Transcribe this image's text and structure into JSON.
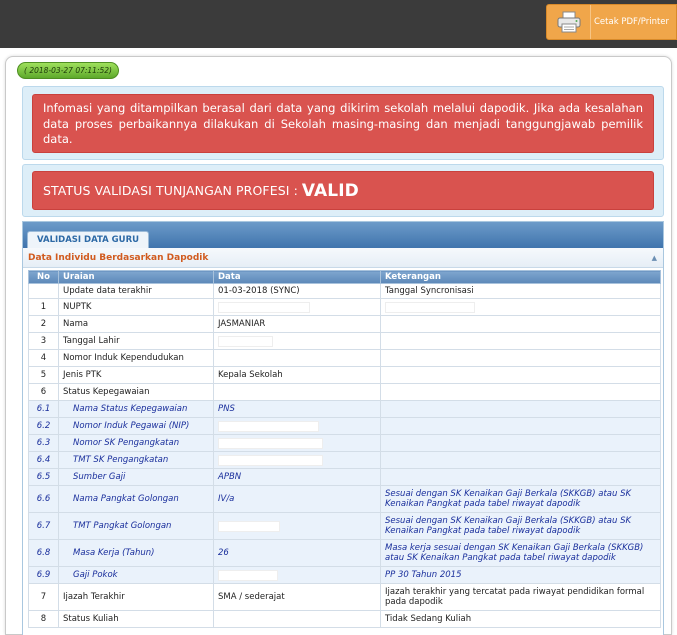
{
  "toolbar": {
    "print_label": "Cetak PDF/Printer"
  },
  "timestamp": "( 2018-03-27 07:11:52)",
  "info_message": "Infomasi yang ditampilkan berasal dari data yang dikirim sekolah melalui dapodik. Jika ada kesalahan data proses perbaikannya dilakukan di Sekolah masing-masing dan menjadi tanggungjawab pemilik data.",
  "status": {
    "label": "STATUS VALIDASI TUNJANGAN PROFESI :",
    "value": "VALID"
  },
  "tab": {
    "label": "VALIDASI DATA GURU"
  },
  "section": {
    "title": "Data Individu Berdasarkan Dapodik"
  },
  "table": {
    "headers": [
      "No",
      "Uraian",
      "Data",
      "Keterangan"
    ],
    "rows": [
      {
        "no": "",
        "uraian": "Update data terakhir",
        "data": "01-03-2018 (SYNC)",
        "keterangan": "Tanggal Syncronisasi"
      },
      {
        "no": "1",
        "uraian": "NUPTK",
        "data": "",
        "keterangan": ""
      },
      {
        "no": "2",
        "uraian": "Nama",
        "data": "JASMANIAR",
        "keterangan": ""
      },
      {
        "no": "3",
        "uraian": "Tanggal Lahir",
        "data": "",
        "keterangan": ""
      },
      {
        "no": "4",
        "uraian": "Nomor Induk Kependudukan",
        "data": "",
        "keterangan": ""
      },
      {
        "no": "5",
        "uraian": "Jenis PTK",
        "data": "Kepala Sekolah",
        "keterangan": ""
      },
      {
        "no": "6",
        "uraian": "Status Kepegawaian",
        "data": "",
        "keterangan": ""
      },
      {
        "no": "6.1",
        "uraian": "Nama Status Kepegawaian",
        "data": "PNS",
        "keterangan": ""
      },
      {
        "no": "6.2",
        "uraian": "Nomor Induk Pegawai (NIP)",
        "data": "",
        "keterangan": ""
      },
      {
        "no": "6.3",
        "uraian": "Nomor SK Pengangkatan",
        "data": "",
        "keterangan": ""
      },
      {
        "no": "6.4",
        "uraian": "TMT SK Pengangkatan",
        "data": "",
        "keterangan": ""
      },
      {
        "no": "6.5",
        "uraian": "Sumber Gaji",
        "data": "APBN",
        "keterangan": ""
      },
      {
        "no": "6.6",
        "uraian": "Nama Pangkat Golongan",
        "data": "IV/a",
        "keterangan": "Sesuai dengan SK Kenaikan Gaji Berkala (SKKGB) atau SK Kenaikan Pangkat pada tabel riwayat dapodik"
      },
      {
        "no": "6.7",
        "uraian": "TMT Pangkat Golongan",
        "data": "",
        "keterangan": "Sesuai dengan SK Kenaikan Gaji Berkala (SKKGB) atau SK Kenaikan Pangkat pada tabel riwayat dapodik"
      },
      {
        "no": "6.8",
        "uraian": "Masa Kerja (Tahun)",
        "data": "26",
        "keterangan": "Masa kerja sesuai dengan SK Kenaikan Gaji Berkala (SKKGB) atau SK Kenaikan Pangkat pada tabel riwayat dapodik"
      },
      {
        "no": "6.9",
        "uraian": "Gaji Pokok",
        "data": "",
        "keterangan": "PP 30 Tahun 2015"
      },
      {
        "no": "7",
        "uraian": "Ijazah Terakhir",
        "data": "SMA / sederajat",
        "keterangan": "Ijazah terakhir yang tercatat pada riwayat pendidikan formal pada dapodik"
      },
      {
        "no": "8",
        "uraian": "Status Kuliah",
        "data": "",
        "keterangan": "Tidak Sedang Kuliah"
      }
    ]
  }
}
